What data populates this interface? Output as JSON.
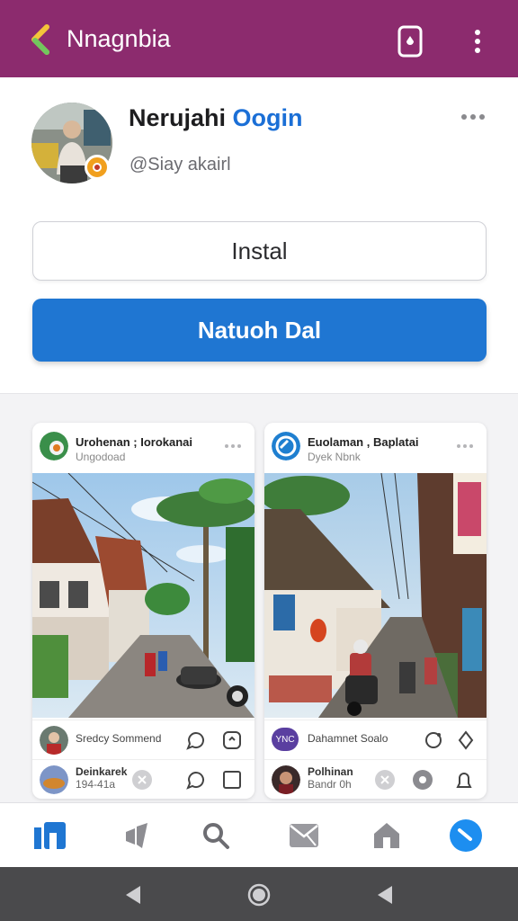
{
  "app_bar": {
    "title": "Nnagnbia",
    "back_icon": "chevron-left-icon",
    "action_icon": "shield-icon",
    "more_icon": "more-vertical-icon"
  },
  "profile": {
    "name_first": "Nerujahi",
    "name_brand": "Oogin",
    "handle": "@Siay akairl",
    "install_label": "Instal",
    "primary_label": "Natuoh Dal"
  },
  "feed": {
    "cards": [
      {
        "title": "Urohenan ; Iorokanai",
        "subtitle": "Ungodoad",
        "row1_title": "Sredcy Sommend",
        "row2_title": "Deinkarek",
        "row2_sub": "194-41a"
      },
      {
        "title": "Euolaman , Baplatai",
        "subtitle": "Dyek Nbnk",
        "row1_title": "Dahamnet Soalo",
        "row1_tag": "YNC",
        "row2_title": "Polhinan",
        "row2_sub": "Bandr 0h"
      }
    ]
  },
  "bottom_nav": {
    "items": [
      "home-icon",
      "megaphone-icon",
      "search-icon",
      "mail-icon",
      "store-icon",
      "compass-icon"
    ]
  },
  "colors": {
    "app_bar": "#8c2b6e",
    "primary": "#1f76d2",
    "accent_blue": "#1b6fd6"
  }
}
